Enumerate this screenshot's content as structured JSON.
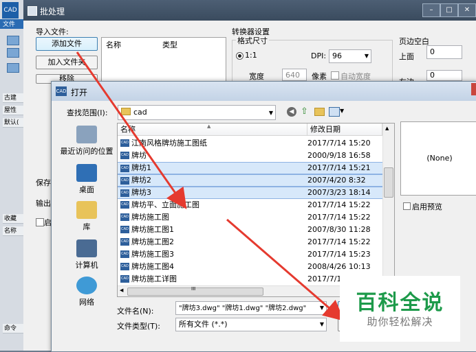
{
  "app": {
    "logo": "CAD",
    "file_tab": "文件",
    "side_labels": [
      "古建",
      "屋性",
      "默认(",
      "收藏",
      "名称",
      "命令"
    ]
  },
  "batch": {
    "title": "批处理",
    "import_label": "导入文件:",
    "add_file": "添加文件",
    "add_folder": "加入文件夹",
    "remove": "移除",
    "col_name": "名称",
    "col_type": "类型",
    "save_label": "保存",
    "output_label": "输出",
    "checkbox_label": "启",
    "converter_label": "转换器设置",
    "format_label": "格式尺寸",
    "ratio": "1:1",
    "dpi_label": "DPI:",
    "dpi_value": "96",
    "width_label": "宽度",
    "width_value": "640",
    "pixel_label": "像素",
    "auto_width": "自动宽度",
    "margin_label": "页边空白",
    "top_label": "上面",
    "top_value": "0",
    "left_label": "左边",
    "left_value": "0"
  },
  "open": {
    "title": "打开",
    "lookin_label": "查找范围(I):",
    "lookin_value": "cad",
    "places": [
      "最近访问的位置",
      "桌面",
      "库",
      "计算机",
      "网络"
    ],
    "col_name": "名称",
    "col_date": "修改日期",
    "files": [
      {
        "name": "江南风格牌坊施工图纸",
        "date": "2017/7/14 15:20",
        "selected": false
      },
      {
        "name": "牌坊",
        "date": "2000/9/18 16:58",
        "selected": false
      },
      {
        "name": "牌坊1",
        "date": "2017/7/14 15:21",
        "selected": true
      },
      {
        "name": "牌坊2",
        "date": "2007/4/20 8:32",
        "selected": true
      },
      {
        "name": "牌坊3",
        "date": "2007/3/23 18:14",
        "selected": true
      },
      {
        "name": "牌坊平、立面施工图",
        "date": "2017/7/14 15:22",
        "selected": false
      },
      {
        "name": "牌坊施工图",
        "date": "2017/7/14 15:22",
        "selected": false
      },
      {
        "name": "牌坊施工图1",
        "date": "2007/8/30 11:28",
        "selected": false
      },
      {
        "name": "牌坊施工图2",
        "date": "2017/7/14 15:22",
        "selected": false
      },
      {
        "name": "牌坊施工图3",
        "date": "2017/7/14 15:23",
        "selected": false
      },
      {
        "name": "牌坊施工图4",
        "date": "2008/4/26 10:13",
        "selected": false
      },
      {
        "name": "牌坊施工详图",
        "date": "2017/7/1",
        "selected": false
      }
    ],
    "preview_text": "(None)",
    "enable_preview": "启用预览",
    "filename_label": "文件名(N):",
    "filename_value": "\"牌坊3.dwg\" \"牌坊1.dwg\" \"牌坊2.dwg\"",
    "filetype_label": "文件类型(T):",
    "filetype_value": "所有文件 (*.*)",
    "hscroll_mark": "III"
  },
  "watermark": {
    "title": "百科全说",
    "subtitle": "助你轻松解决"
  },
  "colors": {
    "arrow": "#e53a2f",
    "selection": "#d7e8fa",
    "watermark_green": "#1d9a4a"
  }
}
